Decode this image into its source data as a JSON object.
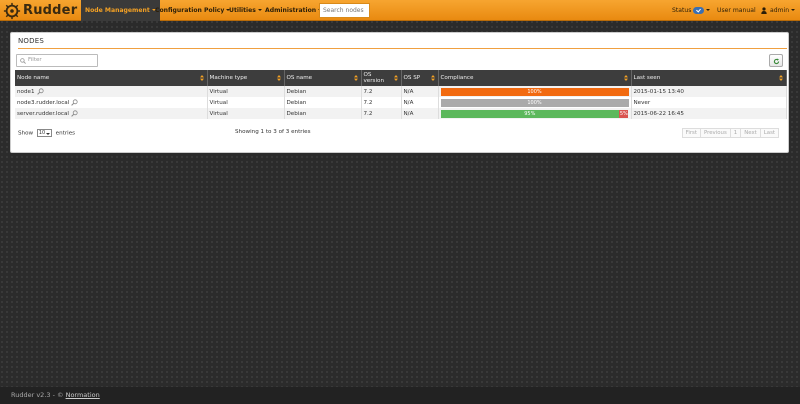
{
  "brand": {
    "name": "Rudder"
  },
  "nav": {
    "node_management": "Node Management",
    "configuration_policy": "Configuration Policy",
    "utilities": "Utilities",
    "administration": "Administration",
    "search_placeholder": "Search nodes",
    "status": "Status",
    "user_manual": "User manual",
    "user": "admin"
  },
  "panel": {
    "title": "NODES",
    "filter_placeholder": "Filter"
  },
  "table": {
    "columns": [
      "Node name",
      "Machine type",
      "OS name",
      "OS version",
      "OS SP",
      "Compliance",
      "Last seen"
    ],
    "rows": [
      {
        "name": "node1",
        "machine": "Virtual",
        "os": "Debian",
        "version": "7.2",
        "sp": "N/A",
        "compliance": [
          {
            "label": "100%",
            "value": 100,
            "color": "#f26a10"
          }
        ],
        "last_seen": "2015-01-15 13:40"
      },
      {
        "name": "node3.rudder.local",
        "machine": "Virtual",
        "os": "Debian",
        "version": "7.2",
        "sp": "N/A",
        "compliance": [
          {
            "label": "100%",
            "value": 100,
            "color": "#aaaaaa"
          }
        ],
        "last_seen": "Never"
      },
      {
        "name": "server.rudder.local",
        "machine": "Virtual",
        "os": "Debian",
        "version": "7.2",
        "sp": "N/A",
        "compliance": [
          {
            "label": "95%",
            "value": 95,
            "color": "#5cb85c"
          },
          {
            "label": "5%",
            "value": 5,
            "color": "#d9534f"
          }
        ],
        "last_seen": "2015-06-22 16:45"
      }
    ]
  },
  "table_footer": {
    "show_label": "Show",
    "show_value": "10",
    "entries_label": "entries",
    "info": "Showing 1 to 3 of 3 entries",
    "pager": [
      "First",
      "Previous",
      "1",
      "Next",
      "Last"
    ]
  },
  "footer": {
    "version": "Rudder v2.3 - ©",
    "link": "Normation"
  },
  "colors": {
    "accent": "#f4a124",
    "nav_active_bg": "#3a3a3a",
    "header_bg": "#3d3d3d"
  },
  "icons": [
    "rudder-logo-icon",
    "caret-down-icon",
    "check-icon",
    "user-icon",
    "filter-icon",
    "refresh-icon",
    "sort-icon",
    "magnifier-icon"
  ]
}
